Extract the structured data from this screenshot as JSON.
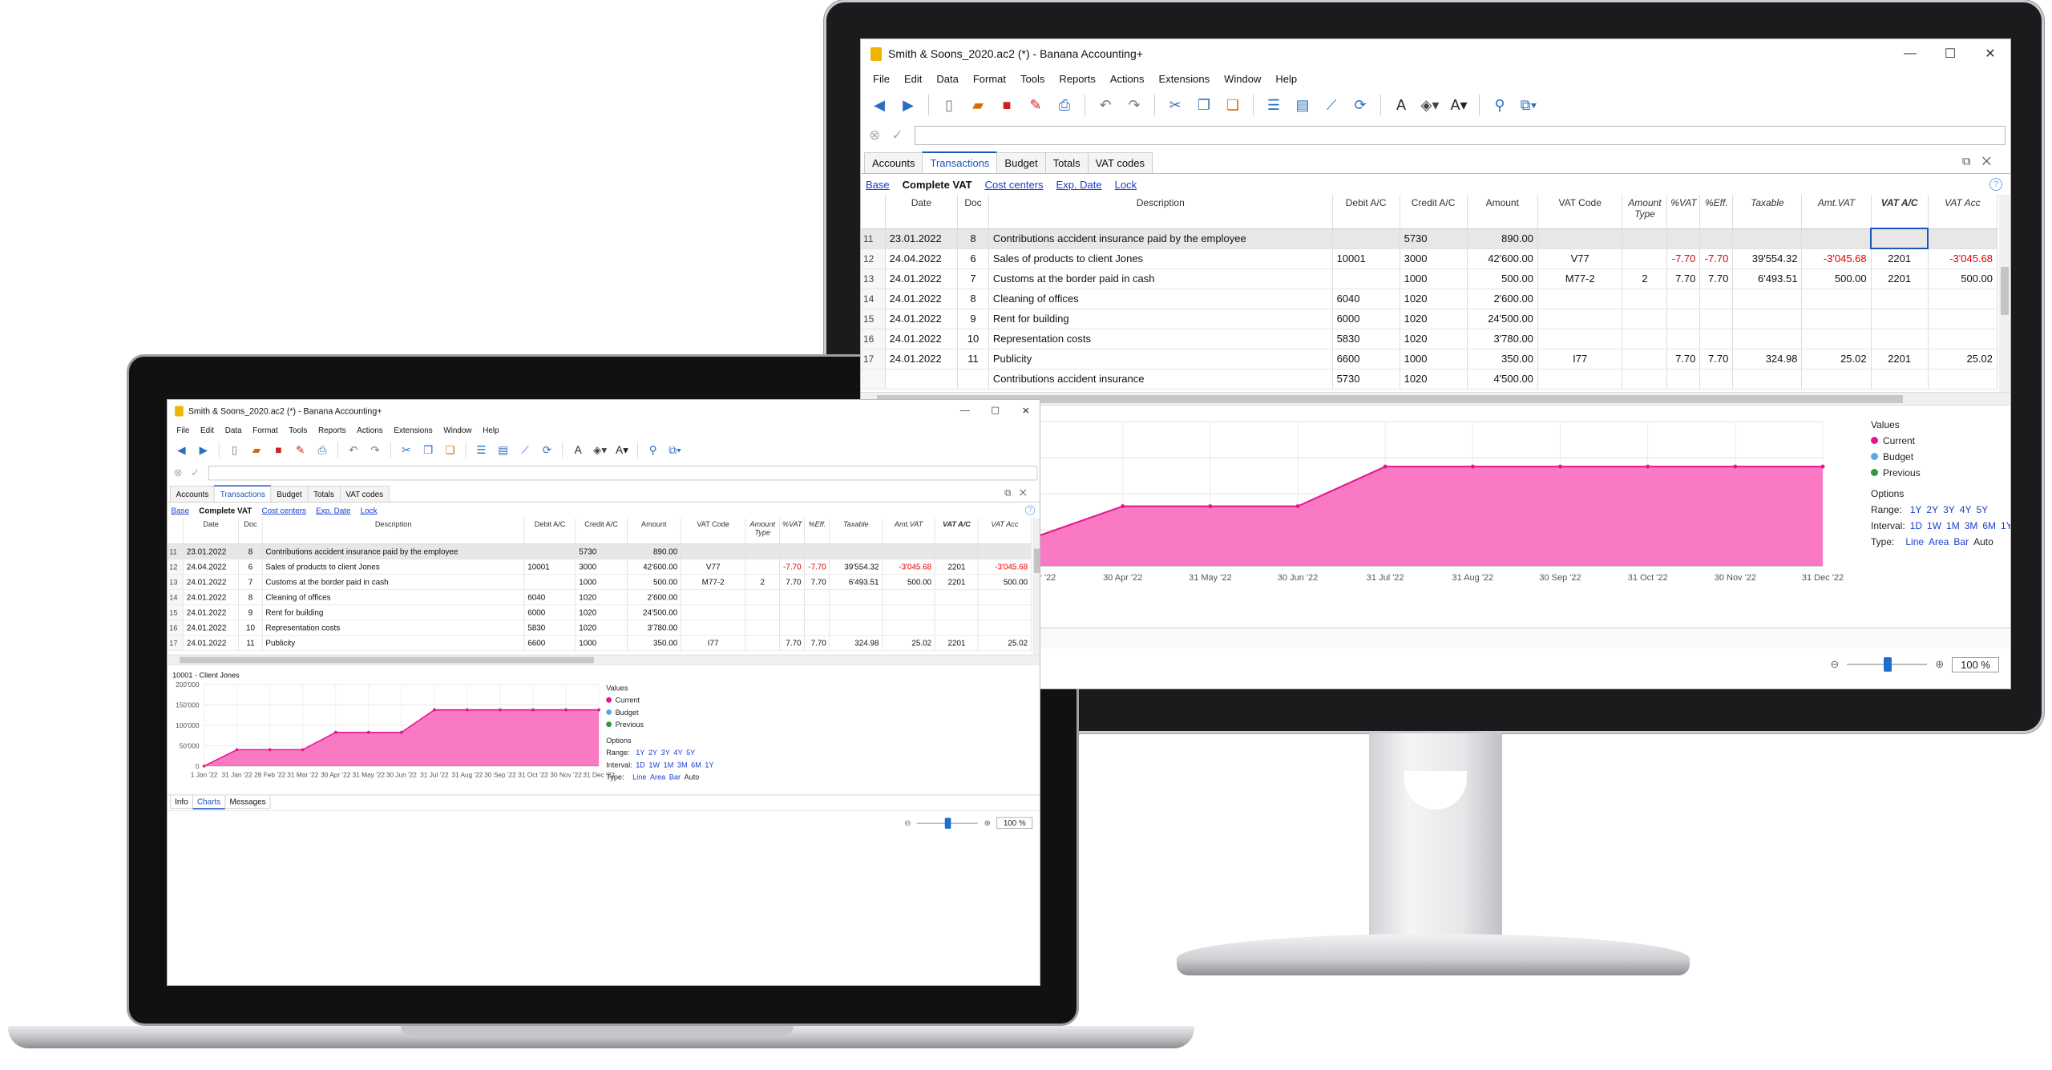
{
  "app": {
    "title": "Smith & Soons_2020.ac2 (*) - Banana Accounting+",
    "window_buttons": [
      "—",
      "☐",
      "✕"
    ]
  },
  "menu": [
    "File",
    "Edit",
    "Data",
    "Format",
    "Tools",
    "Reports",
    "Actions",
    "Extensions",
    "Window",
    "Help"
  ],
  "toolbar_icons": [
    "back-icon",
    "forward-icon",
    "new-file-icon",
    "open-folder-icon",
    "save-icon",
    "pdf-icon",
    "print-preview-icon",
    "undo-icon",
    "redo-icon",
    "cut-icon",
    "copy-icon",
    "paste-icon",
    "insert-rows-icon",
    "table-icon",
    "chart-icon",
    "refresh-icon",
    "font-icon",
    "fill-color-icon",
    "text-color-icon",
    "search-icon",
    "window-icon"
  ],
  "tabs": [
    "Accounts",
    "Transactions",
    "Budget",
    "Totals",
    "VAT codes"
  ],
  "active_tab": "Transactions",
  "views": [
    "Base",
    "Complete VAT",
    "Cost centers",
    "Exp. Date",
    "Lock"
  ],
  "active_view": "Complete VAT",
  "columns": [
    "Date",
    "Doc",
    "Description",
    "Debit A/C",
    "Credit A/C",
    "Amount",
    "VAT Code",
    "Amount Type",
    "%VAT",
    "%Eff.",
    "Taxable",
    "Amt.VAT",
    "VAT A/C",
    "VAT Acc"
  ],
  "rows": [
    {
      "n": "11",
      "date": "23.01.2022",
      "doc": "8",
      "desc": "Contributions accident insurance paid by the employee",
      "debit": "",
      "credit": "5730",
      "amount": "890.00",
      "vat": "",
      "atype": "",
      "pvat": "",
      "peff": "",
      "taxable": "",
      "amtvat": "",
      "vatac": "",
      "vatacc": ""
    },
    {
      "n": "12",
      "date": "24.04.2022",
      "doc": "6",
      "desc": "Sales of products to client Jones",
      "debit": "10001",
      "credit": "3000",
      "amount": "42'600.00",
      "vat": "V77",
      "atype": "",
      "pvat": "-7.70",
      "peff": "-7.70",
      "taxable": "39'554.32",
      "amtvat": "-3'045.68",
      "vatac": "2201",
      "vatacc": "-3'045.68"
    },
    {
      "n": "13",
      "date": "24.01.2022",
      "doc": "7",
      "desc": "Customs at the border paid in cash",
      "debit": "",
      "credit": "1000",
      "amount": "500.00",
      "vat": "M77-2",
      "atype": "2",
      "pvat": "7.70",
      "peff": "7.70",
      "taxable": "6'493.51",
      "amtvat": "500.00",
      "vatac": "2201",
      "vatacc": "500.00"
    },
    {
      "n": "14",
      "date": "24.01.2022",
      "doc": "8",
      "desc": "Cleaning of offices",
      "debit": "6040",
      "credit": "1020",
      "amount": "2'600.00",
      "vat": "",
      "atype": "",
      "pvat": "",
      "peff": "",
      "taxable": "",
      "amtvat": "",
      "vatac": "",
      "vatacc": ""
    },
    {
      "n": "15",
      "date": "24.01.2022",
      "doc": "9",
      "desc": "Rent for building",
      "debit": "6000",
      "credit": "1020",
      "amount": "24'500.00",
      "vat": "",
      "atype": "",
      "pvat": "",
      "peff": "",
      "taxable": "",
      "amtvat": "",
      "vatac": "",
      "vatacc": ""
    },
    {
      "n": "16",
      "date": "24.01.2022",
      "doc": "10",
      "desc": "Representation costs",
      "debit": "5830",
      "credit": "1020",
      "amount": "3'780.00",
      "vat": "",
      "atype": "",
      "pvat": "",
      "peff": "",
      "taxable": "",
      "amtvat": "",
      "vatac": "",
      "vatacc": ""
    },
    {
      "n": "17",
      "date": "24.01.2022",
      "doc": "11",
      "desc": "Publicity",
      "debit": "6600",
      "credit": "1000",
      "amount": "350.00",
      "vat": "I77",
      "atype": "",
      "pvat": "7.70",
      "peff": "7.70",
      "taxable": "324.98",
      "amtvat": "25.02",
      "vatac": "2201",
      "vatacc": "25.02"
    },
    {
      "n": "",
      "date": "",
      "doc": "",
      "desc": "Contributions accident insurance",
      "debit": "5730",
      "credit": "1020",
      "amount": "4'500.00",
      "vat": "",
      "atype": "",
      "pvat": "",
      "peff": "",
      "taxable": "",
      "amtvat": "",
      "vatac": "",
      "vatacc": ""
    }
  ],
  "legend": {
    "values_label": "Values",
    "items": [
      {
        "label": "Current",
        "color": "#e5168c"
      },
      {
        "label": "Budget",
        "color": "#5aa9e6"
      },
      {
        "label": "Previous",
        "color": "#2e9a3a"
      }
    ],
    "options_label": "Options",
    "range_label": "Range:",
    "range": [
      "1Y",
      "2Y",
      "3Y",
      "4Y",
      "5Y"
    ],
    "interval_label": "Interval:",
    "interval": [
      "1D",
      "1W",
      "1M",
      "3M",
      "6M",
      "1Y"
    ],
    "type_label": "Type:",
    "type": [
      "Line",
      "Area",
      "Bar"
    ],
    "type_current": "Auto"
  },
  "bottom_tabs": [
    "Info",
    "Charts",
    "Messages"
  ],
  "active_bottom_tab": "Charts",
  "zoom": "100 %",
  "chart_data": {
    "type": "area",
    "title": "10001 - Client Jones",
    "x": [
      "1 Jan '22",
      "31 Jan '22",
      "28 Feb '22",
      "31 Mar '22",
      "30 Apr '22",
      "31 May '22",
      "30 Jun '22",
      "31 Jul '22",
      "31 Aug '22",
      "30 Sep '22",
      "31 Oct '22",
      "30 Nov '22",
      "31 Dec '22"
    ],
    "series": [
      {
        "name": "Current",
        "color": "#e5168c",
        "values": [
          0,
          40000,
          40000,
          40000,
          82600,
          82600,
          82600,
          137600,
          137600,
          137600,
          137600,
          137600,
          137600
        ]
      }
    ],
    "yticks": [
      "200'000",
      "150'000",
      "100'000",
      "50'000",
      "0"
    ],
    "ylim": [
      0,
      200000
    ],
    "grid": true,
    "legend": "right"
  }
}
